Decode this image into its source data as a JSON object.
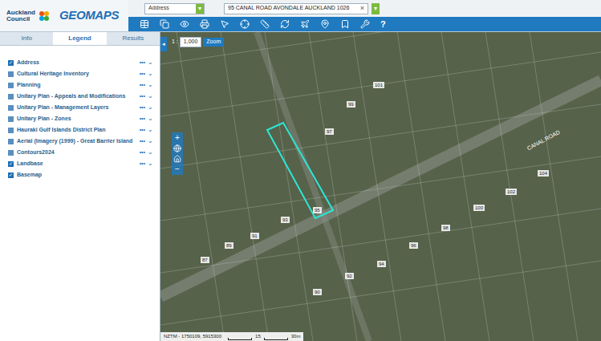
{
  "header": {
    "logo_lines": [
      "Auckland",
      "Council"
    ],
    "app_name": "GEOMAPS",
    "search_type": "Address",
    "search_value": "95 CANAL ROAD AVONDALE AUCKLAND 1026",
    "clear": "×",
    "dropdown": "▾"
  },
  "toolbar": {
    "help": "?"
  },
  "tabs": [
    {
      "label": "Info",
      "selected": false
    },
    {
      "label": "Legend",
      "selected": true
    },
    {
      "label": "Results",
      "selected": false
    }
  ],
  "layers": [
    {
      "label": "Address",
      "checked": true,
      "has_menu": true
    },
    {
      "label": "Cultural Heritage Inventory",
      "checked": false,
      "has_menu": true
    },
    {
      "label": "Planning",
      "checked": false,
      "has_menu": true
    },
    {
      "label": "Unitary Plan - Appeals and Modifications",
      "checked": false,
      "has_menu": true
    },
    {
      "label": "Unitary Plan - Management Layers",
      "checked": false,
      "has_menu": true
    },
    {
      "label": "Unitary Plan - Zones",
      "checked": false,
      "has_menu": true
    },
    {
      "label": "Hauraki Gulf Islands District Plan",
      "checked": false,
      "has_menu": true
    },
    {
      "label": "Aerial (Imagery (1999) - Great Barrier Island",
      "checked": false,
      "has_menu": true
    },
    {
      "label": "Contours2024",
      "checked": false,
      "has_menu": true
    },
    {
      "label": "Landbase",
      "checked": true,
      "has_menu": true
    },
    {
      "label": "Basemap",
      "checked": true,
      "has_menu": false
    }
  ],
  "layer_menu": {
    "more": "•••",
    "expand": "⌄"
  },
  "map": {
    "collapse": "◂",
    "scale_prefix": "1 :",
    "scale": "1,000",
    "zoom_button": "Zoom",
    "zoom_in": "+",
    "zoom_out": "−",
    "street": "CANAL ROAD",
    "parcels": [
      "95",
      "97",
      "93",
      "99",
      "101",
      "91",
      "89",
      "92",
      "94",
      "96",
      "98",
      "87",
      "100",
      "102",
      "104",
      "90"
    ],
    "coordinates": "NZTM - 1750109, 5915300",
    "scale_bar": [
      "15",
      "30m"
    ]
  }
}
